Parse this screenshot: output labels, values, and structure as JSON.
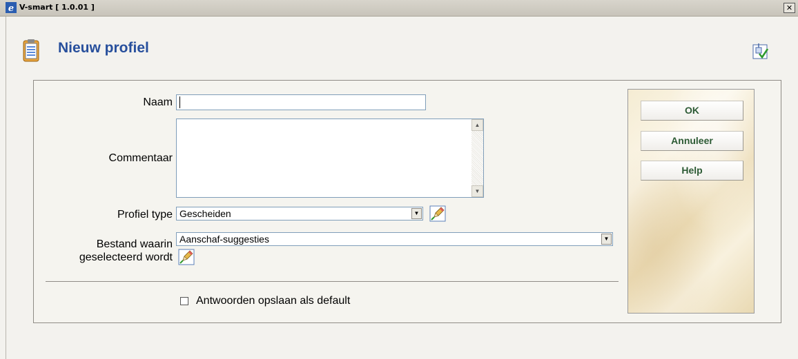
{
  "window": {
    "title": "V-smart [ 1.0.01 ]",
    "close_glyph": "✕"
  },
  "page": {
    "title": "Nieuw profiel"
  },
  "form": {
    "naam": {
      "label": "Naam",
      "value": ""
    },
    "commentaar": {
      "label": "Commentaar",
      "value": ""
    },
    "profiel_type": {
      "label": "Profiel type",
      "value": "Gescheiden"
    },
    "bestand": {
      "label_line1": "Bestand waarin",
      "label_line2": "geselecteerd wordt",
      "value": "Aanschaf-suggesties"
    },
    "default_checkbox": {
      "label": "Antwoorden opslaan als default",
      "checked": false
    }
  },
  "buttons": {
    "ok": "OK",
    "cancel": "Annuleer",
    "help": "Help"
  },
  "icons": {
    "app": "ie-icon",
    "header": "clipboard-icon",
    "corner": "checkmark-form-icon",
    "edit": "pencil-icon"
  },
  "colors": {
    "title": "#274f9c",
    "button_text": "#2c5a34"
  }
}
